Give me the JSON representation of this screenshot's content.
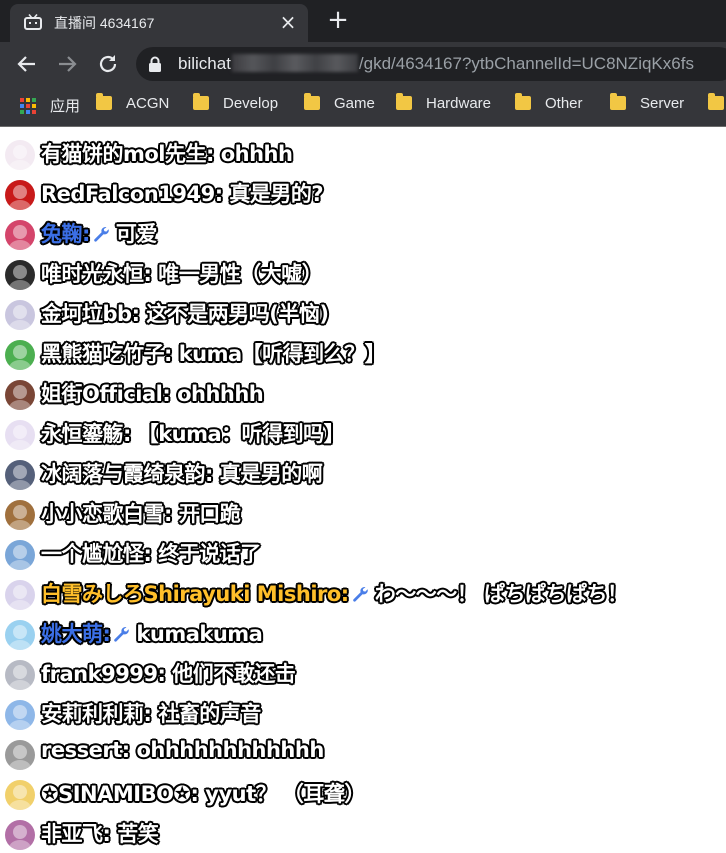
{
  "tab": {
    "title": "直播间 4634167",
    "close": "×",
    "new_tab": "+",
    "favicon": "tv-icon"
  },
  "toolbar": {
    "url_host": "bilichat",
    "url_path": "/gkd/4634167?ytbChannelId=UC8NZiqKx6fs"
  },
  "bookmarks": [
    {
      "label": "应用",
      "icon": "apps-grid-icon"
    },
    {
      "label": "ACGN",
      "icon": "folder-icon"
    },
    {
      "label": "Develop",
      "icon": "folder-icon"
    },
    {
      "label": "Game",
      "icon": "folder-icon"
    },
    {
      "label": "Hardware",
      "icon": "folder-icon"
    },
    {
      "label": "Other",
      "icon": "folder-icon"
    },
    {
      "label": "Server",
      "icon": "folder-icon"
    }
  ],
  "chat": [
    {
      "name": "有猫饼的mol先生:",
      "msg": "ohhhh",
      "type": "normal",
      "avatar": "#f3eaf2"
    },
    {
      "name": "RedFalcon1949:",
      "msg": "真是男的?",
      "type": "normal",
      "avatar": "#c81a1a"
    },
    {
      "name": "兔鞠:",
      "msg": "可爱",
      "type": "member",
      "avatar": "#d4456b"
    },
    {
      "name": "唯时光永恒:",
      "msg": "唯一男性（大嘘）",
      "type": "normal",
      "avatar": "#2b2b2b"
    },
    {
      "name": "金坷垃bb:",
      "msg": "这不是两男吗(半恼)",
      "type": "normal",
      "avatar": "#c9c6df"
    },
    {
      "name": "黑熊猫吃竹子:",
      "msg": "kuma【听得到么？】",
      "type": "normal",
      "avatar": "#4caf50"
    },
    {
      "name": "姐街Official:",
      "msg": "ohhhhh",
      "type": "normal",
      "avatar": "#7a4636"
    },
    {
      "name": "永恒鎏觞:",
      "msg": "【kuma：听得到吗】",
      "type": "normal",
      "avatar": "#e7dff2"
    },
    {
      "name": "冰阔落与霞绮泉韵:",
      "msg": "真是男的啊",
      "type": "normal",
      "avatar": "#55607a"
    },
    {
      "name": "小小恋歌白雪:",
      "msg": "开口跪",
      "type": "normal",
      "avatar": "#a0703d"
    },
    {
      "name": "一个尴尬怪:",
      "msg": "终于说话了",
      "type": "normal",
      "avatar": "#7aa6d8"
    },
    {
      "name": "白雪みしろShirayuki Mishiro:",
      "msg": "わ～～～！ ぱちぱちぱち！",
      "type": "gold",
      "avatar": "#d9d3ec"
    },
    {
      "name": "姚大萌:",
      "msg": "kumakuma",
      "type": "member",
      "avatar": "#9ad1f0"
    },
    {
      "name": "frank9999:",
      "msg": "他们不敢还击",
      "type": "normal",
      "avatar": "#b7bac4"
    },
    {
      "name": "安莉利利莉:",
      "msg": "社畜的声音",
      "type": "normal",
      "avatar": "#8eb7e8"
    },
    {
      "name": "ressert:",
      "msg": "ohhhhhhhhhhhh",
      "type": "normal",
      "avatar": "#9a9a9a"
    },
    {
      "name": "✪SINAMIBO✪:",
      "msg": "yyut？ （耳聋）",
      "type": "normal",
      "avatar": "#f1d06b"
    },
    {
      "name": "非亚飞:",
      "msg": "苦笑",
      "type": "normal",
      "avatar": "#b26fa6"
    }
  ]
}
